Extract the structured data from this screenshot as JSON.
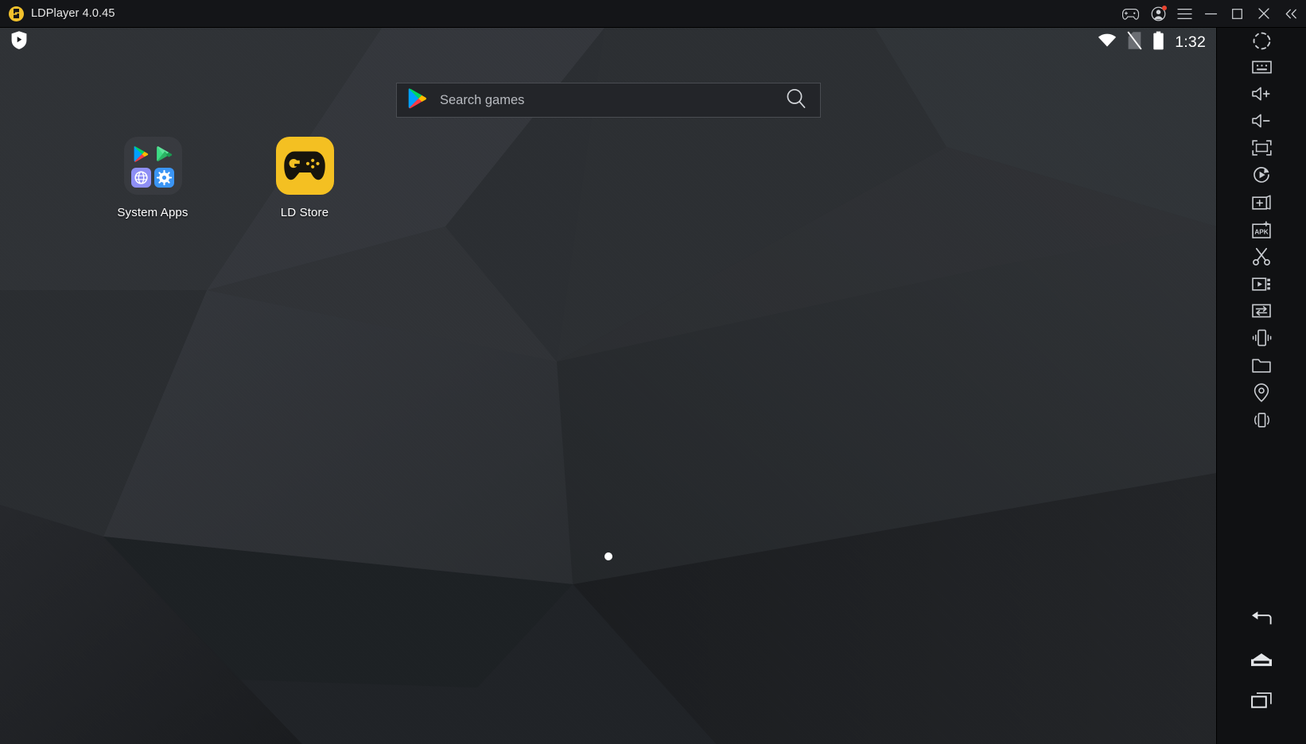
{
  "window": {
    "title": "LDPlayer 4.0.45",
    "logo_icon": "ldplayer-logo-icon",
    "controls": [
      {
        "name": "gamepad-icon",
        "label": "Keyboard mapping"
      },
      {
        "name": "account-icon",
        "label": "Account",
        "badge": true
      },
      {
        "name": "menu-icon",
        "label": "Menu"
      },
      {
        "name": "minimize-icon",
        "label": "Minimize"
      },
      {
        "name": "maximize-icon",
        "label": "Maximize"
      },
      {
        "name": "close-icon",
        "label": "Close"
      },
      {
        "name": "collapse-icon",
        "label": "Collapse sidebar"
      }
    ]
  },
  "statusbar": {
    "watermark_icon": "ldplayer-shield-icon",
    "wifi_icon": "wifi-icon",
    "nosim_icon": "no-sim-icon",
    "battery_icon": "battery-full-icon",
    "time": "1:32"
  },
  "search": {
    "placeholder": "Search games",
    "value": "",
    "play_icon": "google-play-icon",
    "search_icon": "search-icon"
  },
  "desktop": {
    "page_indicator_dots": 1,
    "icons": [
      {
        "name": "system-apps-folder",
        "label": "System Apps",
        "type": "folder",
        "contents": [
          {
            "name": "play-store-icon",
            "label": "Play Store"
          },
          {
            "name": "play-games-icon",
            "label": "Play Games"
          },
          {
            "name": "browser-icon",
            "label": "Browser"
          },
          {
            "name": "settings-icon",
            "label": "Settings"
          }
        ]
      },
      {
        "name": "ld-store-app",
        "label": "LD Store",
        "type": "app",
        "tile_color": "#f4c022",
        "glyph": "gamepad-icon"
      }
    ]
  },
  "sidebar": {
    "tools": [
      {
        "name": "rotate-screen-icon",
        "label": "Rotate screen"
      },
      {
        "name": "keyboard-icon",
        "label": "Virtual keyboard"
      },
      {
        "name": "volume-up-icon",
        "label": "Volume up"
      },
      {
        "name": "volume-down-icon",
        "label": "Volume down"
      },
      {
        "name": "fullscreen-icon",
        "label": "Full screen"
      },
      {
        "name": "macro-record-icon",
        "label": "Operation recorder"
      },
      {
        "name": "new-instance-icon",
        "label": "Multi-instance"
      },
      {
        "name": "install-apk-icon",
        "label": "Install APK"
      },
      {
        "name": "screenshot-icon",
        "label": "Screenshot"
      },
      {
        "name": "video-record-icon",
        "label": "Record screen"
      },
      {
        "name": "shared-folder-icon",
        "label": "File transfer"
      },
      {
        "name": "shake-device-icon",
        "label": "Shake"
      },
      {
        "name": "folder-icon",
        "label": "Shared folder"
      },
      {
        "name": "location-icon",
        "label": "Virtual location"
      },
      {
        "name": "vibrate-icon",
        "label": "Vibrate"
      }
    ],
    "nav": [
      {
        "name": "back-icon",
        "label": "Back"
      },
      {
        "name": "home-icon",
        "label": "Home"
      },
      {
        "name": "recents-icon",
        "label": "Recent apps"
      }
    ]
  },
  "colors": {
    "titlebar_bg": "#141518",
    "brand_yellow": "#f2c12c",
    "wallpaper_base": "#2b2e32",
    "search_bg": "#232529",
    "sidebar_bg": "#101113",
    "notification_red": "#e8432f"
  }
}
